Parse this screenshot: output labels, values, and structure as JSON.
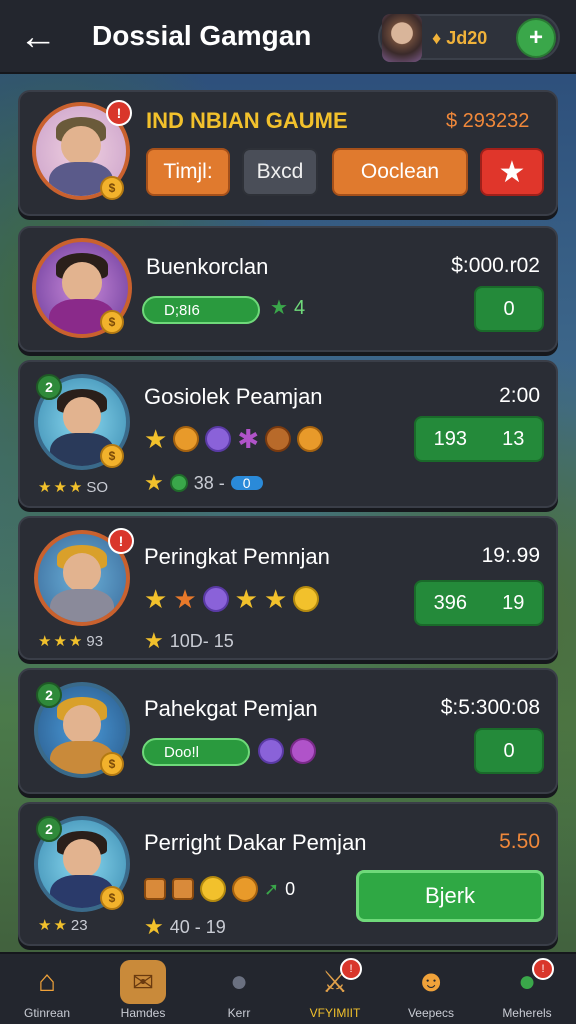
{
  "header": {
    "title": "Dossial Gamgan",
    "back_label": "←",
    "coins": "Jd20",
    "coin_prefix": "♦",
    "plus_label": "+"
  },
  "featured": {
    "title": "IND NBIAN GAUME",
    "amount": "$ 293232",
    "badge": "!",
    "coin_badge": "$",
    "buttons": {
      "tab1": "Timjl:",
      "tab2": "Bxcd",
      "tab3": "Ooclean",
      "close": "★"
    }
  },
  "players": [
    {
      "name": "Buenkorclan",
      "value": "$:000.r02",
      "pill": "D;8I6",
      "extra": "4",
      "box": [
        "0"
      ],
      "rank": "",
      "stars_text": ""
    },
    {
      "name": "Gosiolek Peamjan",
      "value": "2:00",
      "box": [
        "193",
        "13"
      ],
      "rank": "2",
      "stars_text": "SO",
      "meta": "38 -",
      "meta_pill": "0"
    },
    {
      "name": "Peringkat Pemnjan",
      "value": "19:.99",
      "box": [
        "396",
        "19"
      ],
      "rank": "",
      "stars_text": "93",
      "meta": "10D- 15"
    },
    {
      "name": "Pahekgat Pemjan",
      "value": "$:5:300:08",
      "pill": "Doo!l",
      "box": [
        "0"
      ],
      "rank": "2"
    },
    {
      "name": "Perright Dakar Pemjan",
      "value": "5.50",
      "extra": "0",
      "button": "Bjerk",
      "rank": "2",
      "stars_text": "23",
      "meta": "40 - 19"
    }
  ],
  "nav": [
    {
      "label": "Gtinrean"
    },
    {
      "label": "Hamdes"
    },
    {
      "label": "Kerr"
    },
    {
      "label": "VFYIMIIT"
    },
    {
      "label": "Veepecs"
    },
    {
      "label": "Meherels"
    }
  ],
  "colors": {
    "accent_orange": "#e07a2e",
    "green": "#2a9a3e",
    "red": "#e0362b",
    "gold": "#f2c12c",
    "panel": "#2a2d35"
  }
}
